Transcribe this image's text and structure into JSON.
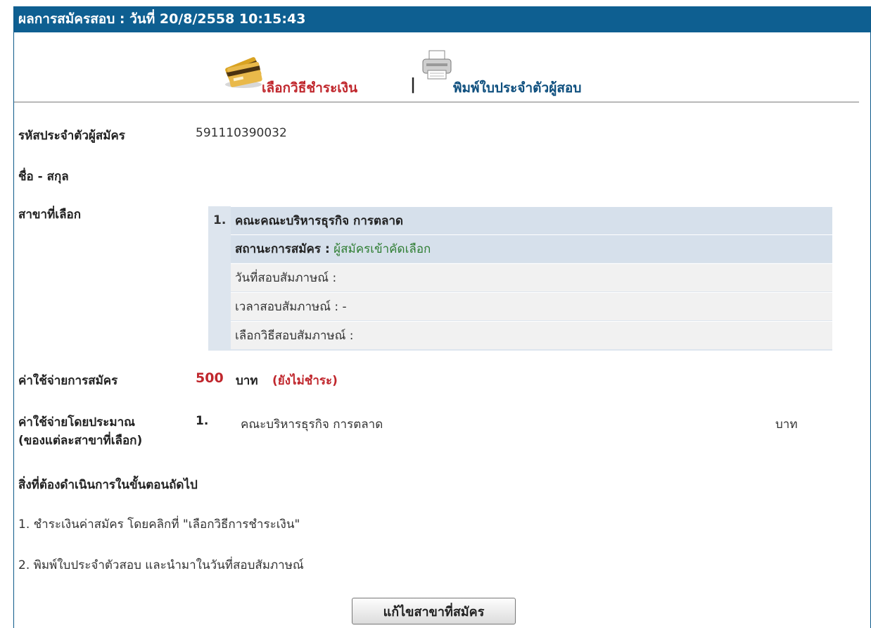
{
  "header": {
    "title": "ผลการสมัครสอบ : วันที่ 20/8/2558 10:15:43"
  },
  "actions": {
    "pay_label": "เลือกวิธีชำระเงิน",
    "separator": "|",
    "print_label": "พิมพ์ใบประจำตัวผู้สอบ",
    "pay_icon": "credit-card-icon",
    "print_icon": "printer-icon"
  },
  "applicant": {
    "id_label": "รหัสประจำตัวผู้สมัคร",
    "id_value": "591110390032",
    "name_label": "ชื่อ - สกุล",
    "name_value": ""
  },
  "majors": {
    "label": "สาขาที่เลือก",
    "items": [
      {
        "number": "1.",
        "name": "คณะคณะบริหารธุรกิจ การตลาด",
        "status_label": "สถานะการสมัคร :",
        "status_value": "ผู้สมัครเข้าคัดเลือก",
        "interview_date": "วันที่สอบสัมภาษณ์ :",
        "interview_time": "เวลาสอบสัมภาษณ์ : -",
        "interview_method": "เลือกวิธีสอบสัมภาษณ์ :"
      }
    ]
  },
  "fee": {
    "label": "ค่าใช้จ่ายการสมัคร",
    "amount": "500",
    "unit": "บาท",
    "status": "(ยังไม่ชำระ)"
  },
  "estimated": {
    "label_line1": "ค่าใช้จ่ายโดยประมาณ",
    "label_line2": "(ของแต่ละสาขาที่เลือก)",
    "number": "1.",
    "name": "คณะบริหารธุรกิจ การตลาด",
    "unit": "บาท"
  },
  "next_steps": {
    "heading": "สิ่งที่ต้องดำเนินการในขั้นตอนถัดไป",
    "step1": "1. ชำระเงินค่าสมัคร โดยคลิกที่ \"เลือกวิธีการชำระเงิน\"",
    "step2": "2. พิมพ์ใบประจำตัวสอบ และนำมาในวันที่สอบสัมภาษณ์"
  },
  "buttons": {
    "edit_major": "แก้ไขสาขาที่สมัคร"
  },
  "colors": {
    "header_bg": "#0e5f91",
    "accent_red": "#c0272d",
    "status_green": "#2e7d32",
    "link_blue": "#0e4f7e"
  }
}
